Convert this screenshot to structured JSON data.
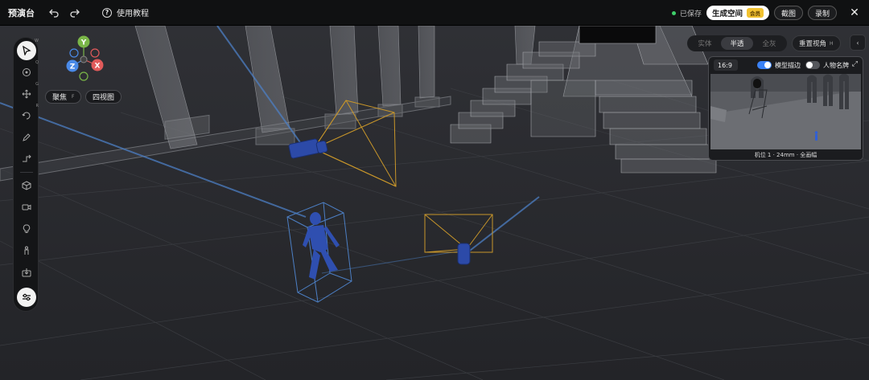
{
  "app": {
    "title": "预演台"
  },
  "header": {
    "tutorial_label": "使用教程",
    "saved_label": "已保存",
    "generate_label": "生成空间",
    "vip_badge": "会员",
    "screenshot_label": "截图",
    "record_label": "录制"
  },
  "toolbar": {
    "hotkeys": {
      "select": "W",
      "orbit": "Q",
      "move": "G",
      "rotate": "R"
    }
  },
  "gizmo": {
    "y": "Y",
    "z": "Z",
    "x": "X"
  },
  "view_buttons": {
    "focus_label": "聚焦",
    "focus_key": "F",
    "quad_label": "四视图"
  },
  "render_modes": {
    "items": [
      "实体",
      "半透",
      "全灰"
    ],
    "active": "半透"
  },
  "reset_view": {
    "label": "重置视角",
    "key": "H"
  },
  "preview": {
    "ratio": "16:9",
    "outline_label": "模型描边",
    "outline_on": true,
    "nameplate_label": "人物名牌",
    "nameplate_on": false,
    "footer": "机位 1 · 24mm · 全画幅"
  },
  "colors": {
    "accent": "#3b82f6",
    "vip": "#f2c230",
    "frustum": "#c8962a",
    "gizmo_y": "#7ab648",
    "gizmo_x": "#e05a5a",
    "gizmo_z": "#4a8ae8"
  }
}
